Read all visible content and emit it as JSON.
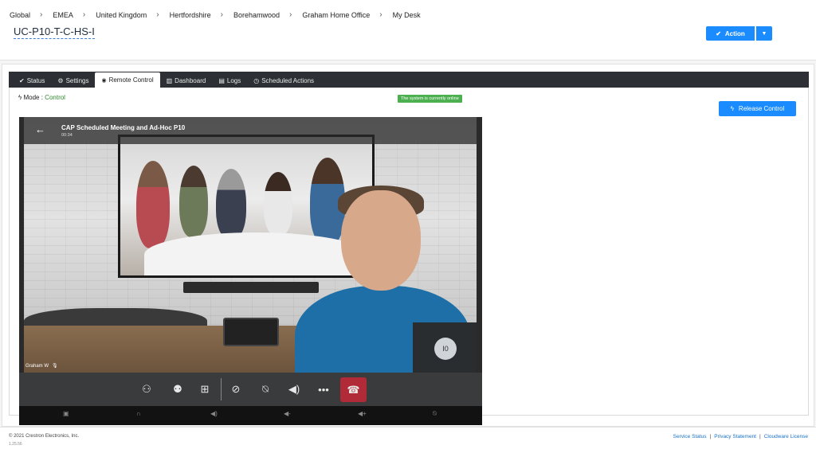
{
  "breadcrumb": [
    "Global",
    "EMEA",
    "United Kingdom",
    "Hertfordshire",
    "Borehamwood",
    "Graham Home Office",
    "My Desk"
  ],
  "device_title": "UC-P10-T-C-HS-I",
  "action_label": "Action",
  "tabs": [
    {
      "label": "Status",
      "icon": "check-icon"
    },
    {
      "label": "Settings",
      "icon": "gear-icon"
    },
    {
      "label": "Remote Control",
      "icon": "rss-icon",
      "active": true
    },
    {
      "label": "Dashboard",
      "icon": "bar-chart-icon"
    },
    {
      "label": "Logs",
      "icon": "list-icon"
    },
    {
      "label": "Scheduled Actions",
      "icon": "clock-icon"
    }
  ],
  "mode": {
    "label": "Mode :",
    "value": "Control"
  },
  "online_status": "The system is currently online",
  "release_label": "Release Control",
  "meeting": {
    "title": "CAP Scheduled Meeting and Ad-Hoc P10",
    "time": "00:34"
  },
  "participant_name": "Graham W",
  "self_view_initials": "I0",
  "footer": {
    "copyright": "© 2021 Crestron Electronics, Inc.",
    "version": "1.25.56",
    "links": [
      "Service Status",
      "Privacy Statement",
      "Cloudware License"
    ]
  },
  "colors": {
    "accent": "#1a8cff",
    "online": "#4caf50",
    "hangup": "#b02a37",
    "mode_value": "#2e8b2e"
  }
}
